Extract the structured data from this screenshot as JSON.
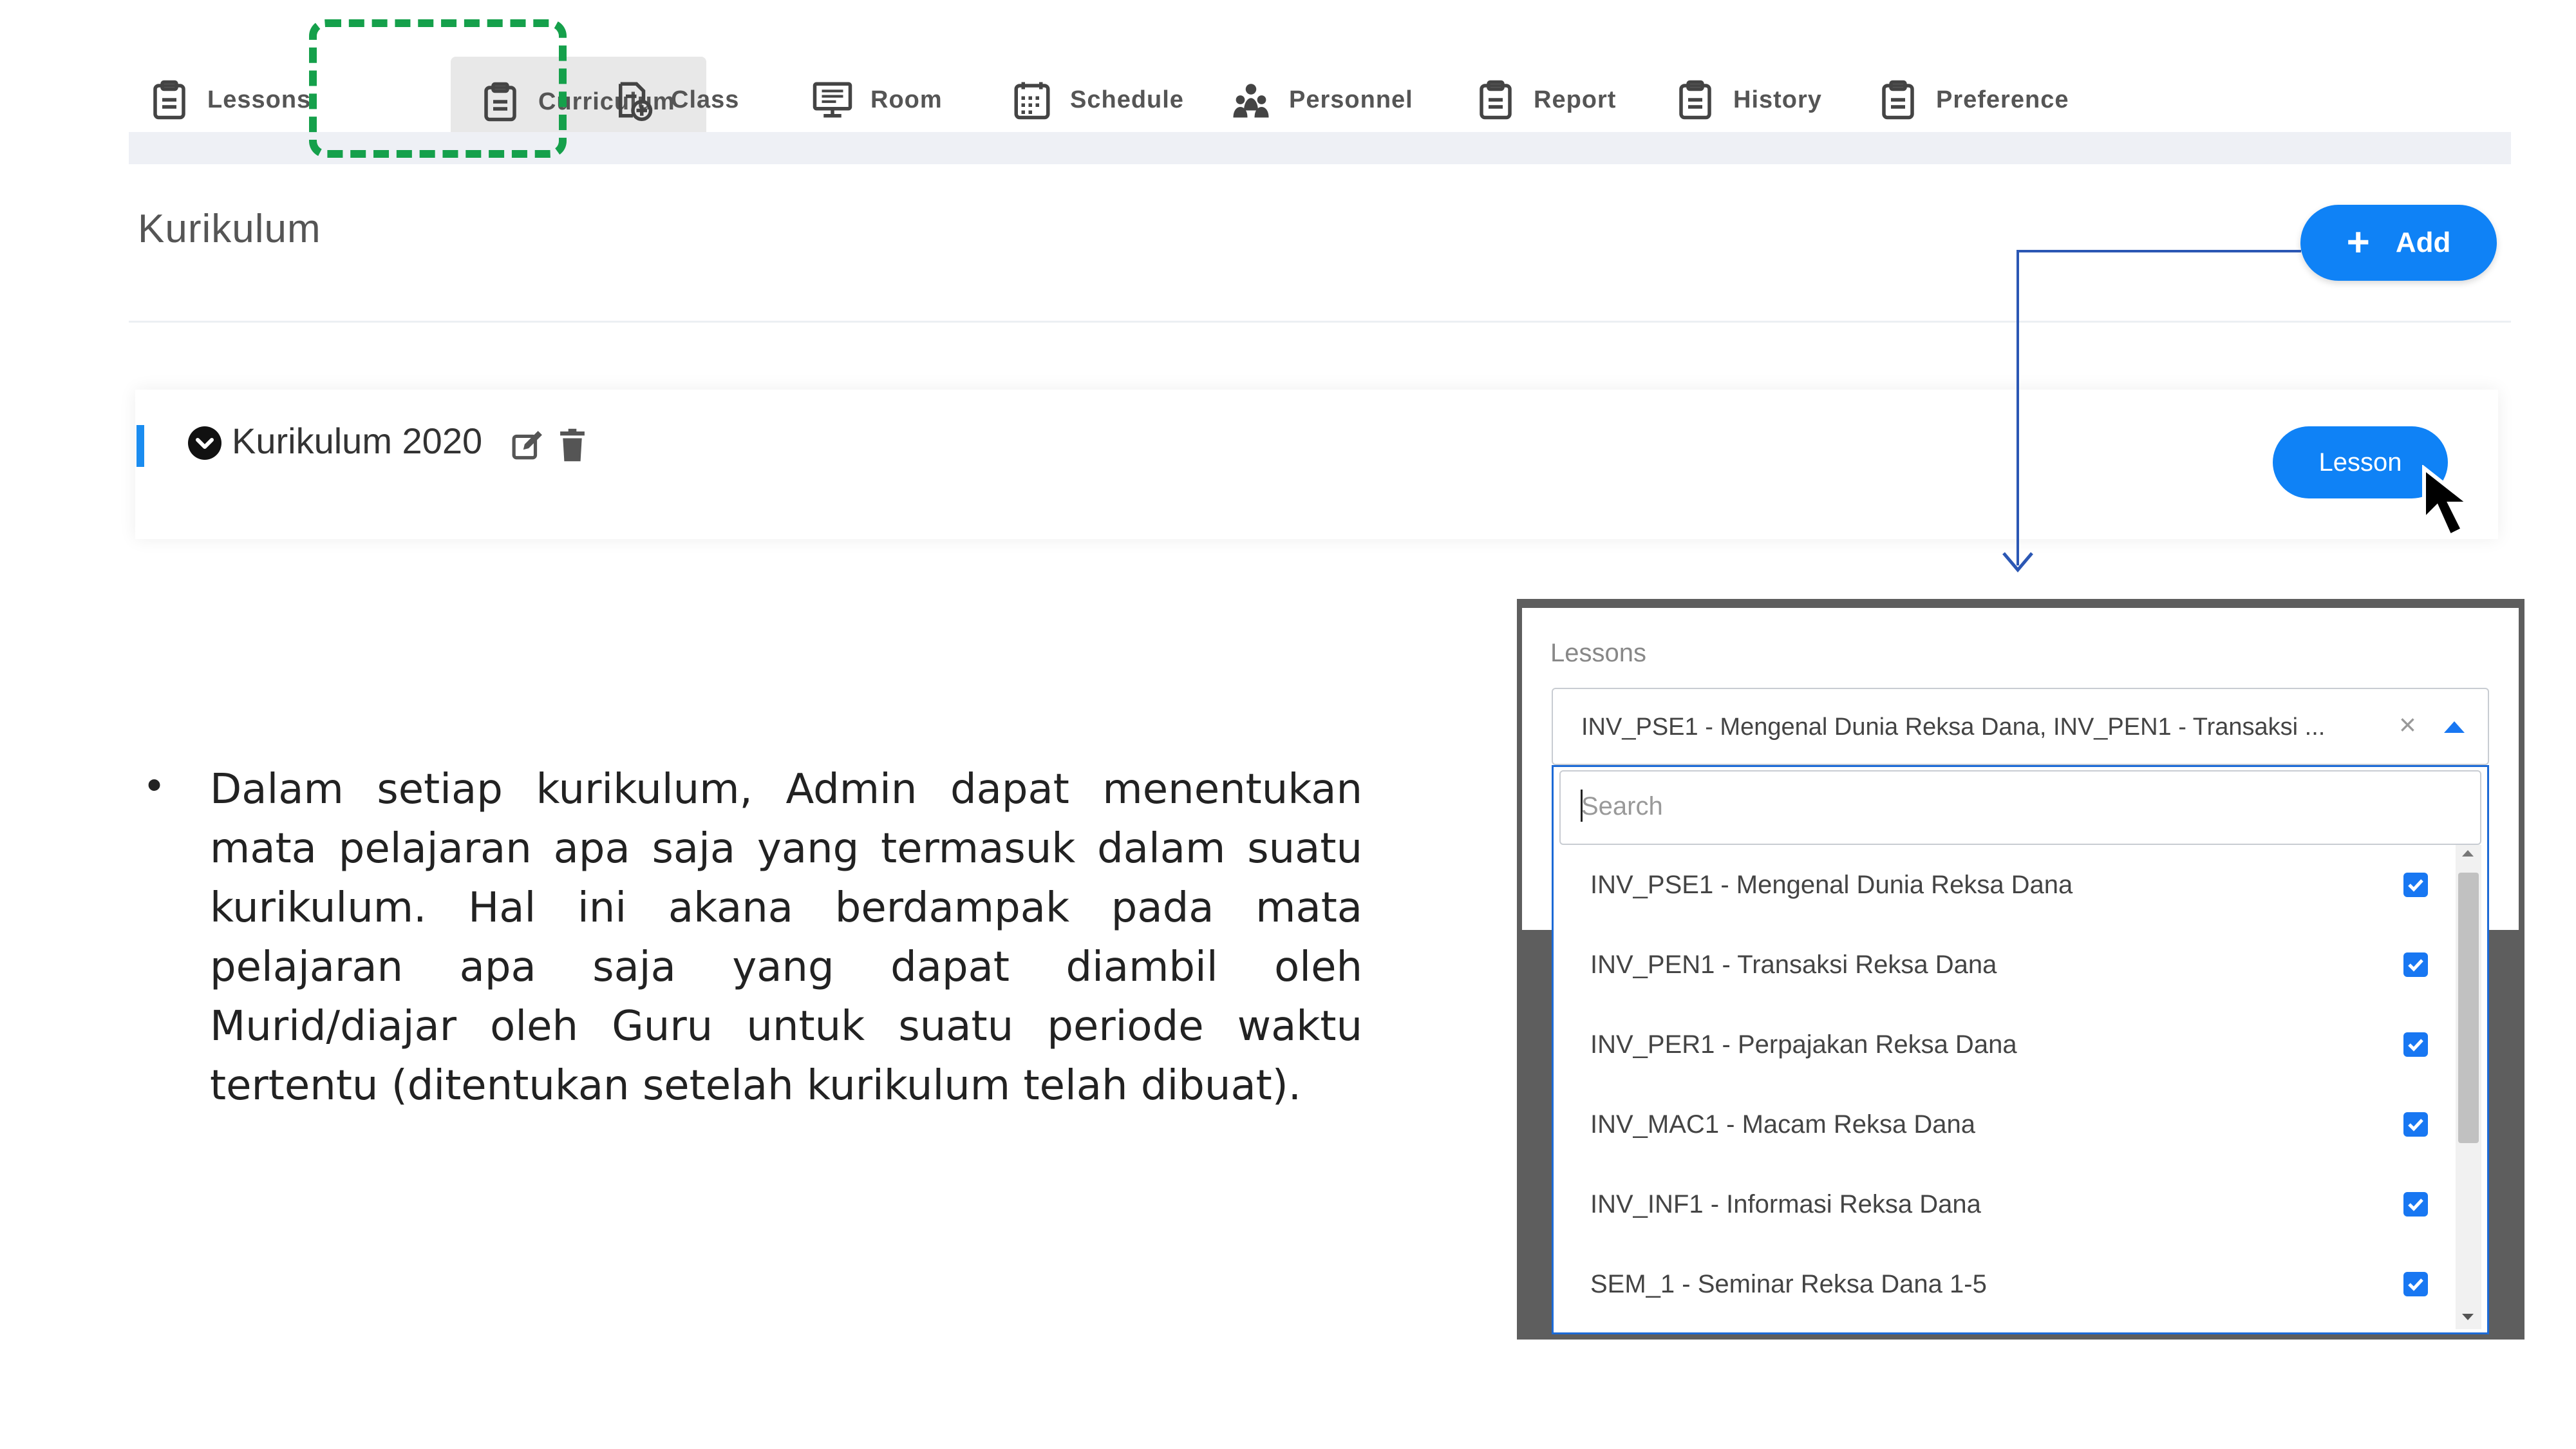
{
  "nav": {
    "tabs": [
      {
        "label": "Lessons",
        "icon": "clipboard-icon"
      },
      {
        "label": "Curriculum",
        "icon": "clipboard-icon",
        "active": true
      },
      {
        "label": "Class",
        "icon": "document-add-icon"
      },
      {
        "label": "Room",
        "icon": "monitor-icon"
      },
      {
        "label": "Schedule",
        "icon": "calendar-icon"
      },
      {
        "label": "Personnel",
        "icon": "people-icon"
      },
      {
        "label": "Report",
        "icon": "clipboard-icon"
      },
      {
        "label": "History",
        "icon": "clipboard-icon"
      },
      {
        "label": "Preference",
        "icon": "clipboard-icon"
      }
    ],
    "highlight_color": "#15a04b"
  },
  "page": {
    "title": "Kurikulum",
    "add_label": "Add",
    "accent_color": "#0f82f6"
  },
  "curriculum": {
    "name": "Kurikulum 2020",
    "lesson_button_label": "Lesson"
  },
  "note": {
    "bullet": "•",
    "text": "Dalam setiap kurikulum, Admin dapat menentukan mata pelajaran apa saja yang termasuk dalam suatu kurikulum. Hal ini akana berdampak pada mata pelajaran apa saja yang dapat diambil oleh Murid/diajar oleh Guru untuk suatu periode waktu tertentu (ditentukan setelah kurikulum telah dibuat)."
  },
  "lessons_modal": {
    "label": "Lessons",
    "selected_text": "INV_PSE1 - Mengenal Dunia Reksa Dana, INV_PEN1 - Transaksi ...",
    "search_placeholder": "Search",
    "options": [
      {
        "label": "INV_PSE1 - Mengenal Dunia Reksa Dana",
        "checked": true
      },
      {
        "label": "INV_PEN1 - Transaksi Reksa Dana",
        "checked": true
      },
      {
        "label": "INV_PER1 - Perpajakan Reksa Dana",
        "checked": true
      },
      {
        "label": "INV_MAC1 - Macam Reksa Dana",
        "checked": true
      },
      {
        "label": "INV_INF1 - Informasi Reksa Dana",
        "checked": true
      },
      {
        "label": "SEM_1 - Seminar Reksa Dana 1-5",
        "checked": true
      }
    ]
  }
}
